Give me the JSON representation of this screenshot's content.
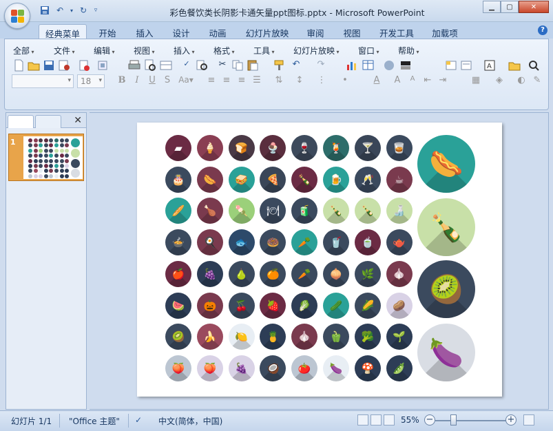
{
  "window": {
    "title": "彩色餐饮类长阴影卡通矢量ppt图标.pptx - Microsoft PowerPoint"
  },
  "ribbon_tabs": [
    {
      "label": "经典菜单",
      "active": true
    },
    {
      "label": "开始"
    },
    {
      "label": "插入"
    },
    {
      "label": "设计"
    },
    {
      "label": "动画"
    },
    {
      "label": "幻灯片放映"
    },
    {
      "label": "审阅"
    },
    {
      "label": "视图"
    },
    {
      "label": "开发工具"
    },
    {
      "label": "加载项"
    }
  ],
  "classic_menu": [
    "全部",
    "文件",
    "编辑",
    "视图",
    "插入",
    "格式",
    "工具",
    "幻灯片放映",
    "窗口",
    "帮助"
  ],
  "format_bar": {
    "font_name": "",
    "font_size": "18"
  },
  "slide_panel": {
    "slide_number": "1"
  },
  "status": {
    "slide_info": "幻灯片 1/1",
    "theme": "\"Office 主题\"",
    "language": "中文(简体，中国)",
    "zoom": "55%"
  },
  "icons": {
    "colors": [
      "#3b4a5e",
      "#7a3a4e",
      "#2aa198",
      "#9bd07a",
      "#e8eef4",
      "#d9d2e6",
      "#c8e0a8",
      "#f4b183",
      "#bcc6d2"
    ],
    "grid": [
      [
        "cheese-icon",
        "ice-cream-cone-icon",
        "bread-loaf-icon",
        "sundae-icon",
        "wine-glass-icon",
        "cocktail-icon",
        "martini-icon",
        "brandy-glass-icon"
      ],
      [
        "birthday-cake-icon",
        "sausage-icon",
        "sandwich-icon",
        "pizza-icon",
        "bottle-icon",
        "beer-mug-icon",
        "champagne-icon",
        "coffee-cup-icon"
      ],
      [
        "baguette-icon",
        "chicken-leg-icon",
        "popsicle-icon",
        "plate-cutlery-icon",
        "juice-box-icon",
        "soda-bottle-icon",
        "beer-bottle-icon",
        "liquor-bottle-icon"
      ],
      [
        "pot-icon",
        "frying-pan-icon",
        "fish-icon",
        "donut-icon",
        "carrot-juice-icon",
        "juice-glass-icon",
        "mug-icon",
        "kettle-icon"
      ],
      [
        "apple-icon",
        "grapes-icon",
        "pear-icon",
        "orange-slice-icon",
        "carrot-icon",
        "onion-icon",
        "scallion-icon",
        "garlic-icon"
      ],
      [
        "watermelon-icon",
        "pumpkin-icon",
        "cherries-icon",
        "strawberry-icon",
        "cabbage-icon",
        "cucumber-icon",
        "corn-icon",
        "potatoes-icon"
      ],
      [
        "kiwi-slice-icon",
        "banana-icon",
        "lemon-icon",
        "pineapple-icon",
        "garlic-bulb-icon",
        "bell-pepper-icon",
        "broccoli-icon",
        "asparagus-icon"
      ],
      [
        "pomegranate-icon",
        "peach-icon",
        "grape-bunch-icon",
        "coconut-icon",
        "tomato-icon",
        "eggplant-small-icon",
        "mushroom-icon",
        "pea-pod-icon"
      ]
    ],
    "featured": [
      "hotdog-icon",
      "wine-bottle-icon",
      "kiwi-icon",
      "eggplant-icon"
    ]
  }
}
